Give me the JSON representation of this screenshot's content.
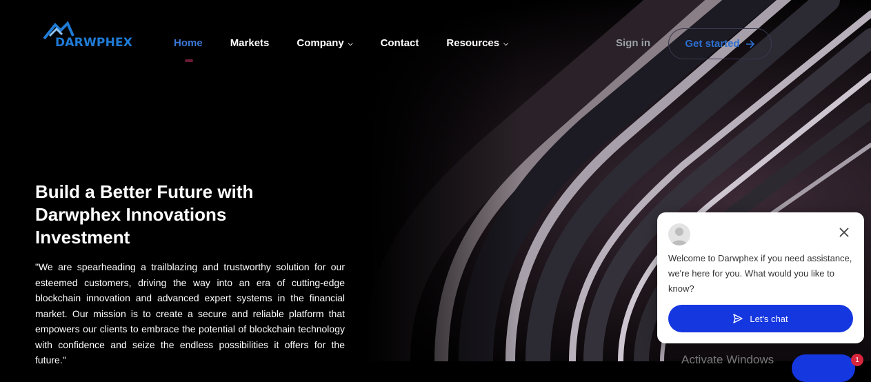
{
  "brand": {
    "name": "DARWPHEX"
  },
  "nav": {
    "items": [
      {
        "label": "Home",
        "active": true,
        "dropdown": false
      },
      {
        "label": "Markets",
        "active": false,
        "dropdown": false
      },
      {
        "label": "Company",
        "active": false,
        "dropdown": true
      },
      {
        "label": "Contact",
        "active": false,
        "dropdown": false
      },
      {
        "label": "Resources",
        "active": false,
        "dropdown": true
      }
    ],
    "signin": "Sign in",
    "cta": "Get started"
  },
  "hero": {
    "title": "Build a Better Future with Darwphex Innovations Investment",
    "text": "\"We are spearheading a trailblazing and trustworthy solution for our esteemed customers, driving the way into an era of cutting-edge blockchain innovation and advanced expert systems in the financial market. Our mission is to create a secure and reliable platform that empowers our clients to embrace the potential of blockchain technology with confidence and seize the endless possibilities it offers for the future.\""
  },
  "chat": {
    "message": "Welcome to Darwphex if you  need assistance, we're here for you.  What would you like to know?",
    "button": "Let's chat",
    "badge": "1"
  },
  "overlay": {
    "activate": "Activate Windows"
  },
  "colors": {
    "accent": "#1537e0",
    "link": "#3b78d8",
    "badge": "#d7263d"
  }
}
